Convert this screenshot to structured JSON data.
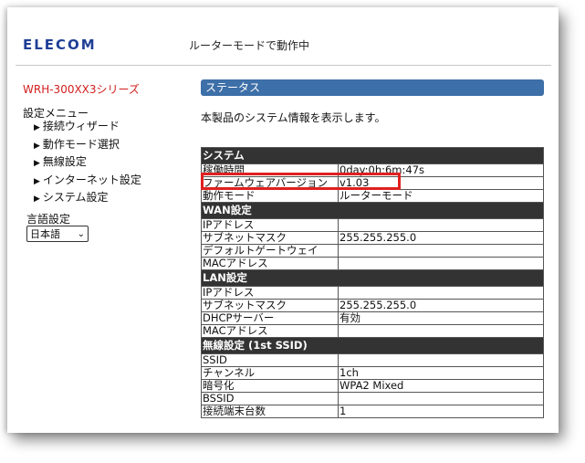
{
  "header": {
    "logo": "ELECOM",
    "mode_text": "ルーターモードで動作中"
  },
  "sidebar": {
    "series": "WRH-300XX3シリーズ",
    "menu_title": "設定メニュー",
    "items": [
      {
        "label": "接続ウィザード"
      },
      {
        "label": "動作モード選択"
      },
      {
        "label": "無線設定"
      },
      {
        "label": "インターネット設定"
      },
      {
        "label": "システム設定"
      }
    ],
    "lang_label": "言語設定",
    "lang_value": "日本語"
  },
  "main": {
    "title": "ステータス",
    "description": "本製品のシステム情報を表示します。",
    "sections": [
      {
        "title": "システム",
        "rows": [
          {
            "key": "稼働時間",
            "value": "0day:0h:6m:47s"
          },
          {
            "key": "ファームウェアバージョン",
            "value": "v1.03"
          },
          {
            "key": "動作モード",
            "value": "ルーターモード"
          }
        ]
      },
      {
        "title": "WAN設定",
        "rows": [
          {
            "key": "IPアドレス",
            "value": ""
          },
          {
            "key": "サブネットマスク",
            "value": "255.255.255.0"
          },
          {
            "key": "デフォルトゲートウェイ",
            "value": ""
          },
          {
            "key": "MACアドレス",
            "value": ""
          }
        ]
      },
      {
        "title": "LAN設定",
        "rows": [
          {
            "key": "IPアドレス",
            "value": ""
          },
          {
            "key": "サブネットマスク",
            "value": "255.255.255.0"
          },
          {
            "key": "DHCPサーバー",
            "value": "有効"
          },
          {
            "key": "MACアドレス",
            "value": ""
          }
        ]
      },
      {
        "title": "無線設定 (1st SSID)",
        "rows": [
          {
            "key": "SSID",
            "value": ""
          },
          {
            "key": "チャンネル",
            "value": "1ch"
          },
          {
            "key": "暗号化",
            "value": "WPA2 Mixed"
          },
          {
            "key": "BSSID",
            "value": ""
          },
          {
            "key": "接続端末台数",
            "value": "1"
          }
        ]
      }
    ]
  },
  "colors": {
    "logo": "#1f3f96",
    "series": "#d21e1e",
    "status_bar": "#3d6fa8",
    "section_header": "#333333",
    "highlight": "#e02020"
  }
}
